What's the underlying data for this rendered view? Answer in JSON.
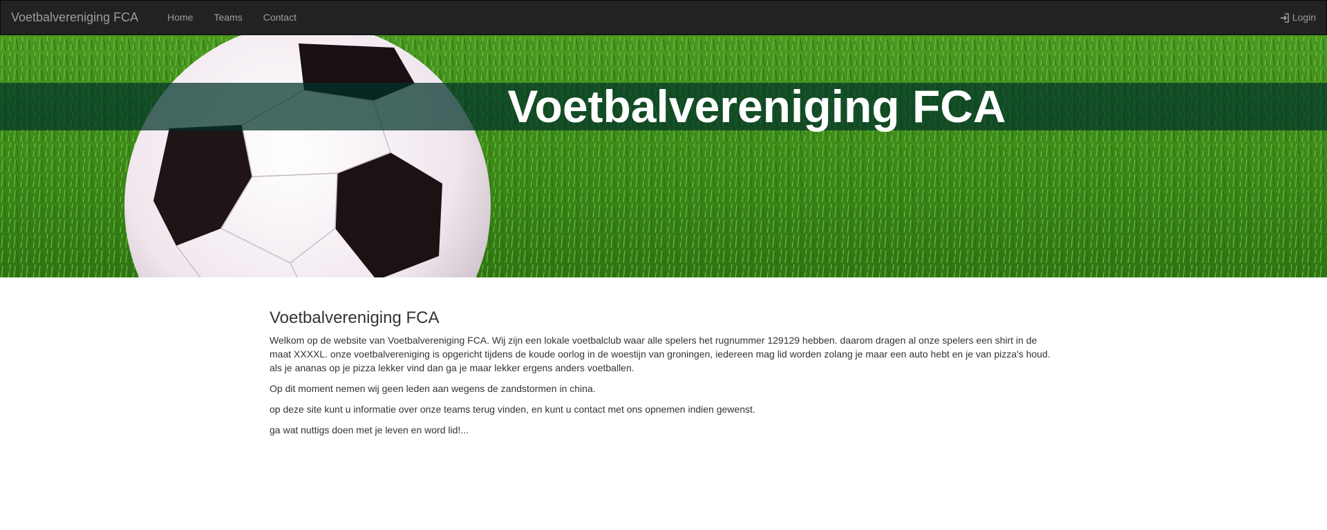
{
  "navbar": {
    "brand": "Voetbalvereniging FCA",
    "links": [
      "Home",
      "Teams",
      "Contact"
    ],
    "login_label": "Login",
    "login_icon": "log-in-icon"
  },
  "hero": {
    "title": "Voetbalvereniging FCA"
  },
  "main": {
    "heading": "Voetbalvereniging FCA",
    "paragraphs": [
      "Welkom op de website van Voetbalvereniging FCA. Wij zijn een lokale voetbalclub waar alle spelers het rugnummer 129129 hebben. daarom dragen al onze spelers een shirt in de maat XXXXL. onze voetbalvereniging is opgericht tijdens de koude oorlog in de woestijn van groningen, iedereen mag lid worden zolang je maar een auto hebt en je van pizza's houd. als je ananas op je pizza lekker vind dan ga je maar lekker ergens anders voetballen.",
      "Op dit moment nemen wij geen leden aan wegens de zandstormen in china.",
      "op deze site kunt u informatie over onze teams terug vinden, en kunt u contact met ons opnemen indien gewenst.",
      "ga wat nuttigs doen met je leven en word lid!..."
    ]
  },
  "colors": {
    "navbar_bg": "#222222",
    "nav_text": "#9d9d9d",
    "grass": "#3f8d1d",
    "band": "#003228"
  }
}
